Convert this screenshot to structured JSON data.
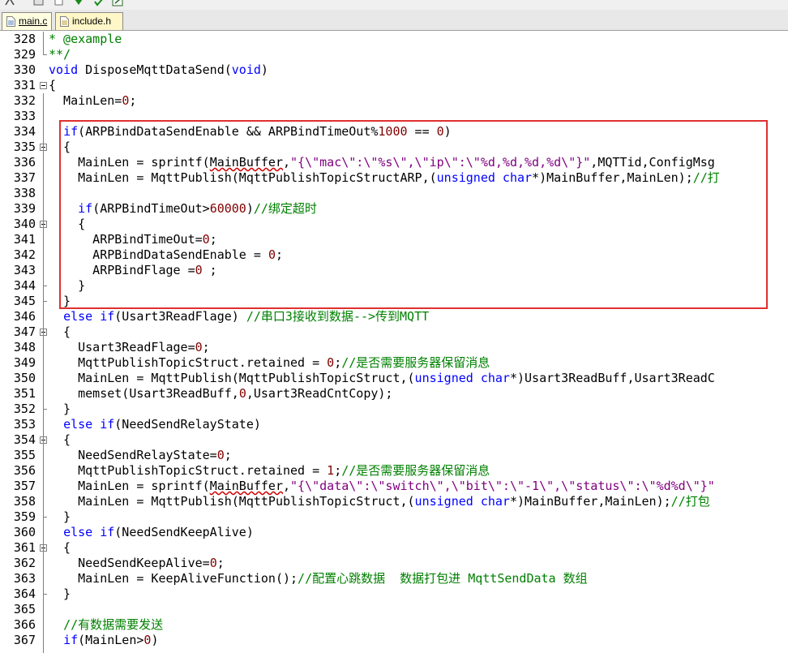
{
  "toolbar": {
    "icons": [
      "compile-icon",
      "window-icon",
      "copy-icon",
      "down-arrow-icon",
      "check-icon",
      "export-icon"
    ]
  },
  "tabs": [
    {
      "label": "main.c",
      "active": true
    },
    {
      "label": "include.h",
      "active": false
    }
  ],
  "editor": {
    "fold_markers": [
      331,
      335,
      340,
      347,
      354,
      361
    ],
    "lines": [
      {
        "n": "328",
        "tokens": [
          [
            "cm",
            "* @example"
          ]
        ]
      },
      {
        "n": "329",
        "tokens": [
          [
            "cm",
            "**/"
          ]
        ]
      },
      {
        "n": "330",
        "tokens": [
          [
            "kw",
            "void"
          ],
          [
            "",
            " DisposeMqttDataSend("
          ],
          [
            "kw",
            "void"
          ],
          [
            "",
            ")"
          ]
        ]
      },
      {
        "n": "331",
        "tokens": [
          [
            "",
            "{"
          ]
        ]
      },
      {
        "n": "332",
        "tokens": [
          [
            "",
            "  MainLen="
          ],
          [
            "nu",
            "0"
          ],
          [
            "",
            ";"
          ]
        ]
      },
      {
        "n": "333",
        "tokens": []
      },
      {
        "n": "334",
        "tokens": [
          [
            "",
            "  "
          ],
          [
            "kw",
            "if"
          ],
          [
            "",
            "(ARPBindDataSendEnable && ARPBindTimeOut%"
          ],
          [
            "nu",
            "1000"
          ],
          [
            "",
            " == "
          ],
          [
            "nu",
            "0"
          ],
          [
            "",
            ")"
          ]
        ]
      },
      {
        "n": "335",
        "tokens": [
          [
            "",
            "  {"
          ]
        ]
      },
      {
        "n": "336",
        "tokens": [
          [
            "",
            "    MainLen = sprintf("
          ],
          [
            "sq",
            "MainBuffer"
          ],
          [
            "",
            ","
          ],
          [
            "st",
            "\"{\\\"mac\\\":\\\"%s\\\",\\\"ip\\\":\\\"%d,%d,%d,%d\\\"}\""
          ],
          [
            "",
            ",MQTTid,ConfigMsg"
          ]
        ]
      },
      {
        "n": "337",
        "tokens": [
          [
            "",
            "    MainLen = MqttPublish(MqttPublishTopicStructARP,("
          ],
          [
            "kw",
            "unsigned"
          ],
          [
            "",
            " "
          ],
          [
            "kw",
            "char"
          ],
          [
            "",
            "*)MainBuffer,MainLen);"
          ],
          [
            "cm",
            "//打"
          ]
        ]
      },
      {
        "n": "338",
        "tokens": []
      },
      {
        "n": "339",
        "tokens": [
          [
            "",
            "    "
          ],
          [
            "kw",
            "if"
          ],
          [
            "",
            "(ARPBindTimeOut>"
          ],
          [
            "nu",
            "60000"
          ],
          [
            "",
            ")"
          ],
          [
            "cm",
            "//绑定超时"
          ]
        ]
      },
      {
        "n": "340",
        "tokens": [
          [
            "",
            "    {"
          ]
        ]
      },
      {
        "n": "341",
        "tokens": [
          [
            "",
            "      ARPBindTimeOut="
          ],
          [
            "nu",
            "0"
          ],
          [
            "",
            ";"
          ]
        ]
      },
      {
        "n": "342",
        "tokens": [
          [
            "",
            "      ARPBindDataSendEnable = "
          ],
          [
            "nu",
            "0"
          ],
          [
            "",
            ";"
          ]
        ]
      },
      {
        "n": "343",
        "tokens": [
          [
            "",
            "      ARPBindFlage ="
          ],
          [
            "nu",
            "0"
          ],
          [
            "",
            " ;"
          ]
        ]
      },
      {
        "n": "344",
        "tokens": [
          [
            "",
            "    }"
          ]
        ]
      },
      {
        "n": "345",
        "tokens": [
          [
            "",
            "  }"
          ]
        ]
      },
      {
        "n": "346",
        "tokens": [
          [
            "",
            "  "
          ],
          [
            "kw",
            "else if"
          ],
          [
            "",
            "(Usart3ReadFlage) "
          ],
          [
            "cm",
            "//串口3接收到数据-->传到MQTT"
          ]
        ]
      },
      {
        "n": "347",
        "tokens": [
          [
            "",
            "  {"
          ]
        ]
      },
      {
        "n": "348",
        "tokens": [
          [
            "",
            "    Usart3ReadFlage="
          ],
          [
            "nu",
            "0"
          ],
          [
            "",
            ";"
          ]
        ]
      },
      {
        "n": "349",
        "tokens": [
          [
            "",
            "    MqttPublishTopicStruct.retained = "
          ],
          [
            "nu",
            "0"
          ],
          [
            "",
            ";"
          ],
          [
            "cm",
            "//是否需要服务器保留消息"
          ]
        ]
      },
      {
        "n": "350",
        "tokens": [
          [
            "",
            "    MainLen = MqttPublish(MqttPublishTopicStruct,("
          ],
          [
            "kw",
            "unsigned"
          ],
          [
            "",
            " "
          ],
          [
            "kw",
            "char"
          ],
          [
            "",
            "*)Usart3ReadBuff,Usart3ReadC"
          ]
        ]
      },
      {
        "n": "351",
        "tokens": [
          [
            "",
            "    memset(Usart3ReadBuff,"
          ],
          [
            "nu",
            "0"
          ],
          [
            "",
            ",Usart3ReadCntCopy);"
          ]
        ]
      },
      {
        "n": "352",
        "tokens": [
          [
            "",
            "  }"
          ]
        ]
      },
      {
        "n": "353",
        "tokens": [
          [
            "",
            "  "
          ],
          [
            "kw",
            "else if"
          ],
          [
            "",
            "(NeedSendRelayState)"
          ]
        ]
      },
      {
        "n": "354",
        "tokens": [
          [
            "",
            "  {"
          ]
        ]
      },
      {
        "n": "355",
        "tokens": [
          [
            "",
            "    NeedSendRelayState="
          ],
          [
            "nu",
            "0"
          ],
          [
            "",
            ";"
          ]
        ]
      },
      {
        "n": "356",
        "tokens": [
          [
            "",
            "    MqttPublishTopicStruct.retained = "
          ],
          [
            "nu",
            "1"
          ],
          [
            "",
            ";"
          ],
          [
            "cm",
            "//是否需要服务器保留消息"
          ]
        ]
      },
      {
        "n": "357",
        "tokens": [
          [
            "",
            "    MainLen = sprintf("
          ],
          [
            "sq",
            "MainBuffer"
          ],
          [
            "",
            ","
          ],
          [
            "st",
            "\"{\\\"data\\\":\\\"switch\\\",\\\"bit\\\":\\\"-1\\\",\\\"status\\\":\\\"%d%d\\\"}\""
          ]
        ]
      },
      {
        "n": "358",
        "tokens": [
          [
            "",
            "    MainLen = MqttPublish(MqttPublishTopicStruct,("
          ],
          [
            "kw",
            "unsigned"
          ],
          [
            "",
            " "
          ],
          [
            "kw",
            "char"
          ],
          [
            "",
            "*)MainBuffer,MainLen);"
          ],
          [
            "cm",
            "//打包"
          ]
        ]
      },
      {
        "n": "359",
        "tokens": [
          [
            "",
            "  }"
          ]
        ]
      },
      {
        "n": "360",
        "tokens": [
          [
            "",
            "  "
          ],
          [
            "kw",
            "else if"
          ],
          [
            "",
            "(NeedSendKeepAlive)"
          ]
        ]
      },
      {
        "n": "361",
        "tokens": [
          [
            "",
            "  {"
          ]
        ]
      },
      {
        "n": "362",
        "tokens": [
          [
            "",
            "    NeedSendKeepAlive="
          ],
          [
            "nu",
            "0"
          ],
          [
            "",
            ";"
          ]
        ]
      },
      {
        "n": "363",
        "tokens": [
          [
            "",
            "    MainLen = KeepAliveFunction();"
          ],
          [
            "cm",
            "//配置心跳数据  数据打包进 MqttSendData 数组"
          ]
        ]
      },
      {
        "n": "364",
        "tokens": [
          [
            "",
            "  }"
          ]
        ]
      },
      {
        "n": "365",
        "tokens": []
      },
      {
        "n": "366",
        "tokens": [
          [
            "",
            "  "
          ],
          [
            "cm",
            "//有数据需要发送"
          ]
        ]
      },
      {
        "n": "367",
        "tokens": [
          [
            "",
            "  "
          ],
          [
            "kw",
            "if"
          ],
          [
            "",
            "(MainLen>"
          ],
          [
            "nu",
            "0"
          ],
          [
            "",
            ")"
          ]
        ]
      }
    ]
  },
  "colors": {
    "keyword": "#0000ff",
    "comment": "#008000",
    "string": "#800080",
    "number": "#800000",
    "highlight_box": "#e03030"
  }
}
